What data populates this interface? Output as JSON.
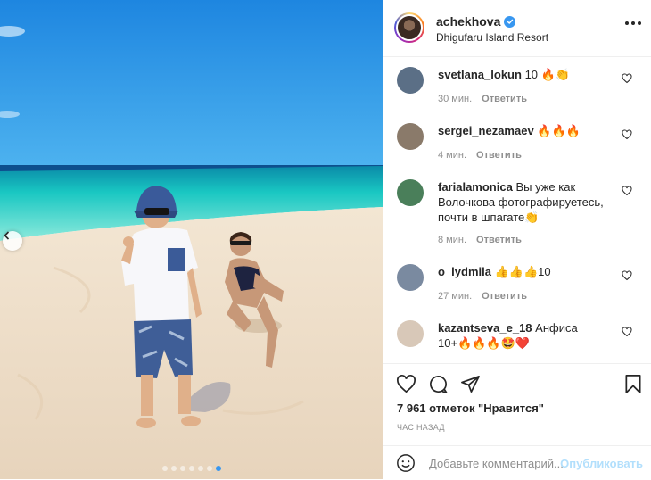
{
  "post": {
    "username": "achekhova",
    "location": "Dhigufaru Island Resort",
    "verified": true,
    "carousel": {
      "slides": 7,
      "active_index": 6
    }
  },
  "comments": [
    {
      "username": "svetlana_lokun",
      "text": "10 🔥👏",
      "time": "30 мин.",
      "reply": "Ответить",
      "avatar_color": "#5b6f86"
    },
    {
      "username": "sergei_nezamaev",
      "text": "🔥🔥🔥",
      "time": "4 мин.",
      "reply": "Ответить",
      "avatar_color": "#8a7a6a"
    },
    {
      "username": "farialamonica",
      "text": "Вы уже как Волочкова фотографируетесь, почти в шпагате👏",
      "time": "8 мин.",
      "reply": "Ответить",
      "avatar_color": "#4a7f5a"
    },
    {
      "username": "o_lydmila",
      "text": "👍👍👍10",
      "time": "27 мин.",
      "reply": "Ответить",
      "avatar_color": "#7a8aa0"
    },
    {
      "username": "kazantseva_e_18",
      "text": "Анфиса 10+🔥🔥🔥🤩❤️",
      "time": "",
      "reply": "",
      "avatar_color": "#d8c8b8"
    }
  ],
  "actions": {
    "likes": "7 961 отметок \"Нравится\"",
    "time_ago": "ЧАС НАЗАД"
  },
  "add_comment": {
    "placeholder": "Добавьте комментарий...",
    "publish": "Опубликовать"
  },
  "colors": {
    "link_blue": "#3897f0",
    "publish_disabled": "#b2dffc",
    "meta_gray": "#8e8e8e"
  },
  "icons": [
    "chevron-left-icon",
    "verified-icon",
    "more-options-icon",
    "heart-icon",
    "comment-icon",
    "share-icon",
    "bookmark-icon",
    "emoji-icon"
  ]
}
